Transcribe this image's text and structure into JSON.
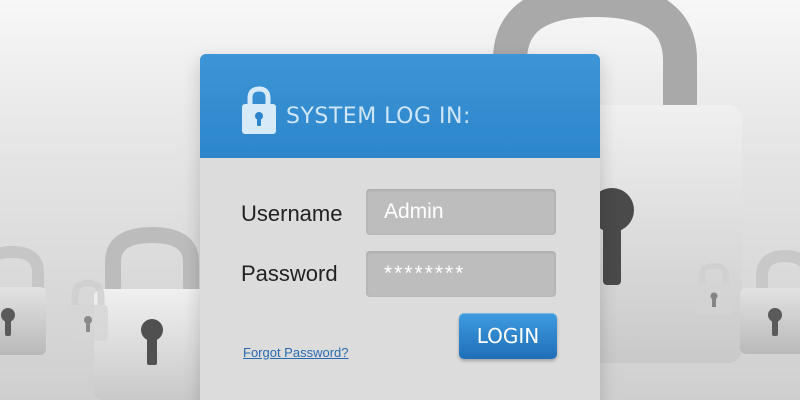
{
  "header": {
    "title": "SYSTEM LOG IN:",
    "icon": "padlock-icon"
  },
  "form": {
    "username_label": "Username",
    "username_value": "Admin",
    "password_label": "Password",
    "password_value": "********",
    "forgot_password_text": "Forgot Password?",
    "login_label": "LOGIN"
  },
  "colors": {
    "header_blue": "#2d86cb",
    "button_blue": "#1f6fb8",
    "panel_gray": "#dcdcdc",
    "input_gray": "#bdbdbd",
    "link_blue": "#2a6bb0"
  },
  "background": {
    "icon": "padlock-icon",
    "count": 6
  }
}
